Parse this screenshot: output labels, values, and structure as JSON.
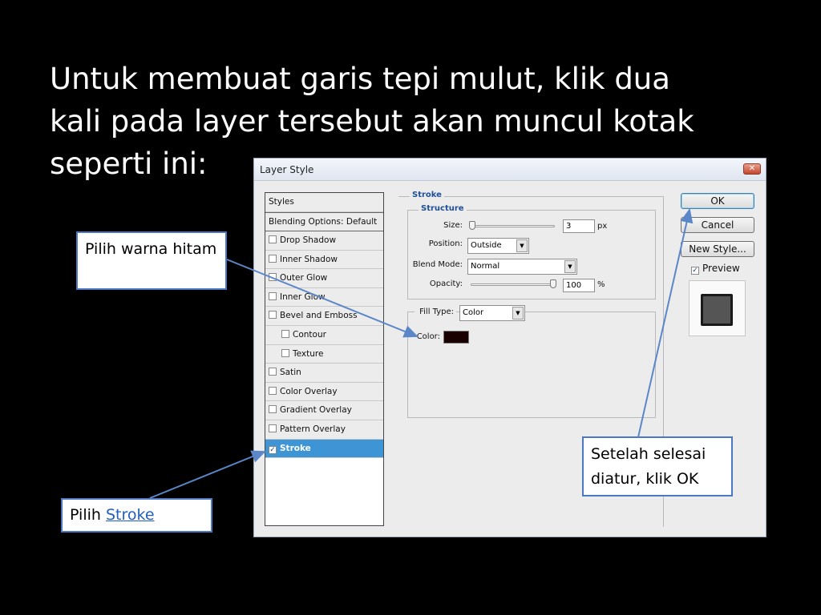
{
  "slide": {
    "title_lines": [
      "Untuk membuat garis tepi mulut, klik dua",
      "kali pada layer tersebut akan muncul kotak",
      "seperti ini:"
    ]
  },
  "dialog": {
    "title": "Layer Style",
    "close_glyph": "✕",
    "styles_list": {
      "header": "Styles",
      "blending": "Blending Options: Default",
      "items": [
        {
          "label": "Drop Shadow",
          "checked": false
        },
        {
          "label": "Inner Shadow",
          "checked": false
        },
        {
          "label": "Outer Glow",
          "checked": false
        },
        {
          "label": "Inner Glow",
          "checked": false
        },
        {
          "label": "Bevel and Emboss",
          "checked": false
        },
        {
          "label": "Contour",
          "checked": false
        },
        {
          "label": "Texture",
          "checked": false
        },
        {
          "label": "Satin",
          "checked": false
        },
        {
          "label": "Color Overlay",
          "checked": false
        },
        {
          "label": "Gradient Overlay",
          "checked": false
        },
        {
          "label": "Pattern Overlay",
          "checked": false
        },
        {
          "label": "Stroke",
          "checked": true
        }
      ]
    },
    "stroke": {
      "legend": "Stroke",
      "structure_legend": "Structure",
      "size_label": "Size:",
      "size_value": "3",
      "size_unit": "px",
      "position_label": "Position:",
      "position_value": "Outside",
      "blend_label": "Blend Mode:",
      "blend_value": "Normal",
      "opacity_label": "Opacity:",
      "opacity_value": "100",
      "opacity_unit": "%",
      "opacity_level": 1.0,
      "size_level": 0.0,
      "fill_type_label": "Fill Type:",
      "fill_type_value": "Color",
      "color_label": "Color:",
      "color_swatch": "#1a0000"
    },
    "buttons": {
      "ok": "OK",
      "cancel": "Cancel",
      "new_style": "New Style..."
    },
    "preview": {
      "label": "Preview",
      "checked": true
    }
  },
  "callouts": {
    "warna": "Pilih warna hitam",
    "stroke_prefix": "Pilih ",
    "stroke_link": "Stroke",
    "ok": "Setelah selesai diatur, klik OK"
  },
  "colors": {
    "accent_selected": "#3d95d6",
    "callout_border": "#4a78c2",
    "arrow": "#5b86c8"
  }
}
